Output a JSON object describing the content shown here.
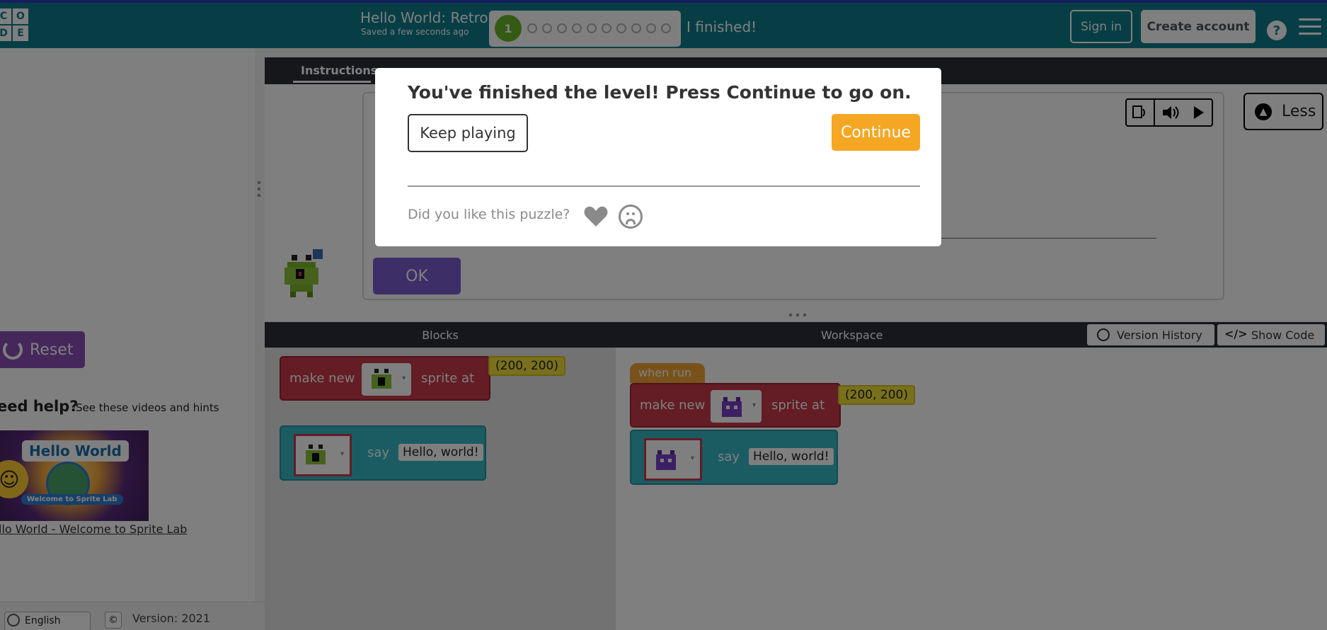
{
  "header": {
    "logo_letters": [
      "C",
      "O",
      "D",
      "E"
    ],
    "level_title": "Hello World: Retro",
    "saved_status": "Saved a few seconds ago",
    "current_level": "1",
    "finished_label": "I finished!",
    "sign_in": "Sign in",
    "create_account": "Create account",
    "help": "?"
  },
  "instructions": {
    "tab_label": "Instructions",
    "ok_button": "OK",
    "less_button": "Less"
  },
  "sidebar": {
    "reset_button": "Reset",
    "need_help": "eed help?",
    "need_help_sub": "See these videos and hints",
    "video_title": "Hello World",
    "video_subtitle": "Welcome to Sprite Lab",
    "video_link": "llo World - Welcome to Sprite Lab",
    "language": "English",
    "copyright_icon": "©",
    "version": "Version: 2021"
  },
  "blocks_panel": {
    "title": "Blocks",
    "make_new_label": "make new",
    "sprite_at_label": "sprite at",
    "coords": "(200, 200)",
    "say_label": "say",
    "say_text": "Hello, world!"
  },
  "workspace": {
    "title": "Workspace",
    "version_history": "Version History",
    "show_code": "Show Code",
    "when_run": "when run",
    "make_new_label": "make new",
    "sprite_at_label": "sprite at",
    "coords": "(200, 200)",
    "say_label": "say",
    "say_text": "Hello, world!"
  },
  "dialog": {
    "title": "You've finished the level! Press Continue to go on.",
    "keep_playing": "Keep playing",
    "continue": "Continue",
    "feedback_question": "Did you like this puzzle?"
  },
  "colors": {
    "header": "#0e7d8c",
    "continue": "#f5a623",
    "reset": "#8a4fb8",
    "block_red": "#c8384a",
    "block_teal": "#36b8c6"
  }
}
